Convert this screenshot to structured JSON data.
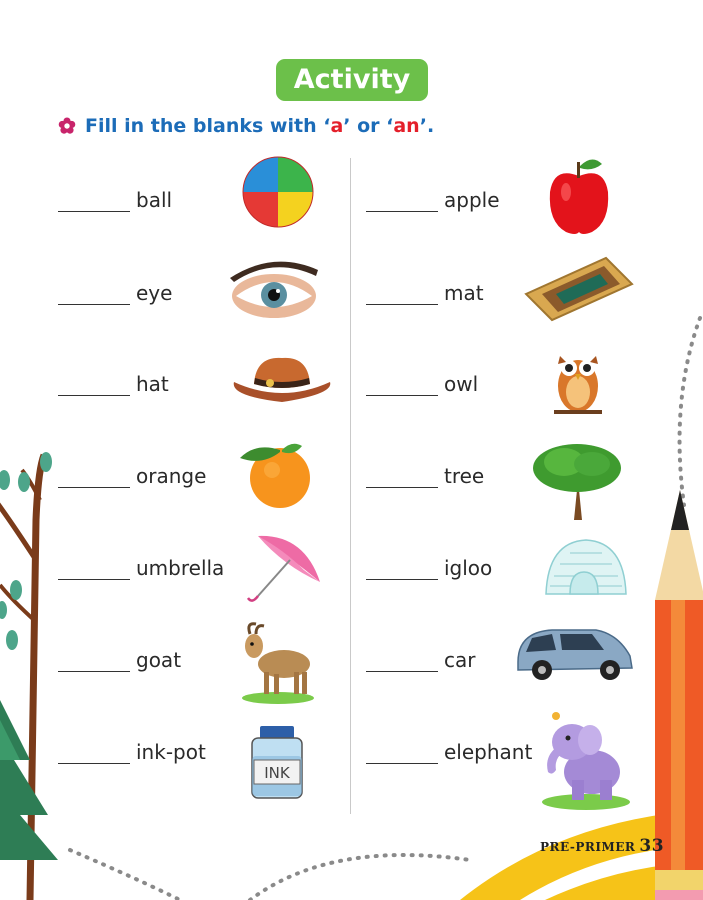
{
  "title": "Activity",
  "instruction": {
    "prefix": "Fill in the blanks with ",
    "q_open1": "‘",
    "opt1": "a",
    "q_close1": "’",
    "mid": " or ",
    "q_open2": "‘",
    "opt2": "an",
    "q_close2": "’",
    "suffix": "."
  },
  "left_items": [
    "ball",
    "eye",
    "hat",
    "orange",
    "umbrella",
    "goat",
    "ink-pot"
  ],
  "right_items": [
    "apple",
    "mat",
    "owl",
    "tree",
    "igloo",
    "car",
    "elephant"
  ],
  "ink_label": "INK",
  "footer": {
    "label": "PRE-PRIMER",
    "page": "33"
  },
  "colors": {
    "title_bg": "#6cc04a",
    "instruction": "#1c6cb8",
    "accent_red": "#e41f2a"
  }
}
